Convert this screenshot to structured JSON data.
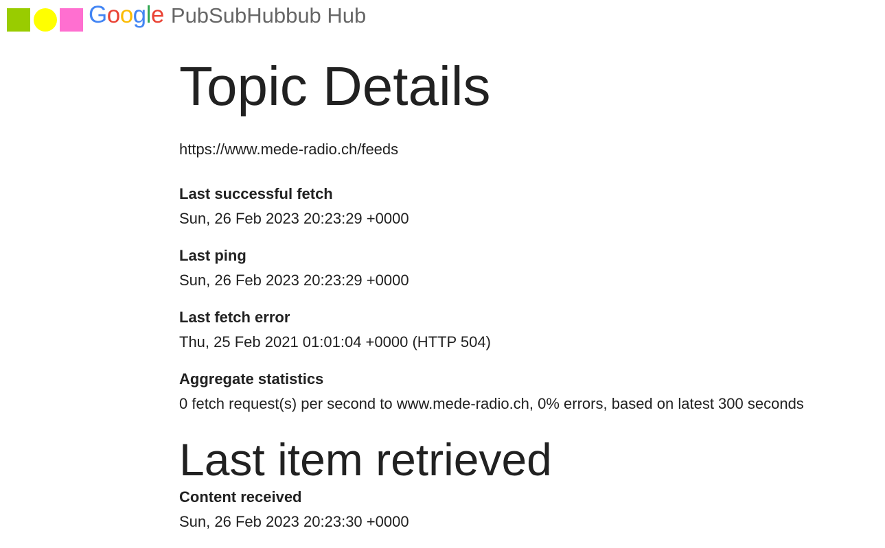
{
  "header": {
    "logo_google": [
      "G",
      "o",
      "o",
      "g",
      "l",
      "e"
    ],
    "logo_colors": {
      "green_square": "#99cc00",
      "yellow_circle": "#ffff00",
      "pink_square": "#ff6fd0"
    },
    "title": "PubSubHubbub Hub"
  },
  "main": {
    "heading": "Topic Details",
    "topic_url": "https://www.mede-radio.ch/feeds",
    "fields": [
      {
        "label": "Last successful fetch",
        "value": "Sun, 26 Feb 2023 20:23:29 +0000"
      },
      {
        "label": "Last ping",
        "value": "Sun, 26 Feb 2023 20:23:29 +0000"
      },
      {
        "label": "Last fetch error",
        "value": "Thu, 25 Feb 2021 01:01:04 +0000 (HTTP 504)"
      },
      {
        "label": "Aggregate statistics",
        "value": "0 fetch request(s) per second to www.mede-radio.ch, 0% errors, based on latest 300 seconds"
      }
    ],
    "last_item": {
      "heading": "Last item retrieved",
      "fields": [
        {
          "label": "Content received",
          "value": "Sun, 26 Feb 2023 20:23:30 +0000"
        }
      ]
    }
  }
}
